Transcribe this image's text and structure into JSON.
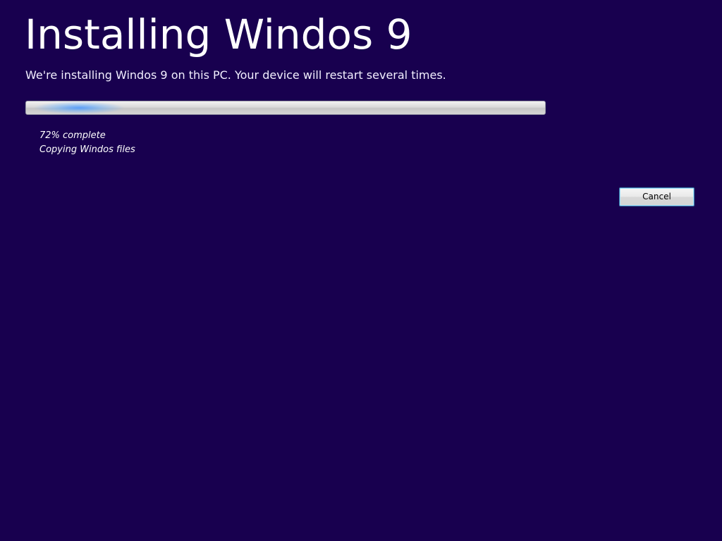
{
  "header": {
    "title": "Installing Windos 9",
    "subtitle": "We're installing Windos 9 on this PC. Your device will restart several times."
  },
  "progress": {
    "percent_text": "72% complete",
    "step_text": "Copying Windos files"
  },
  "actions": {
    "cancel_label": "Cancel"
  },
  "colors": {
    "background": "#18004f",
    "text": "#ffffff",
    "progress_glow": "#4696ff"
  }
}
